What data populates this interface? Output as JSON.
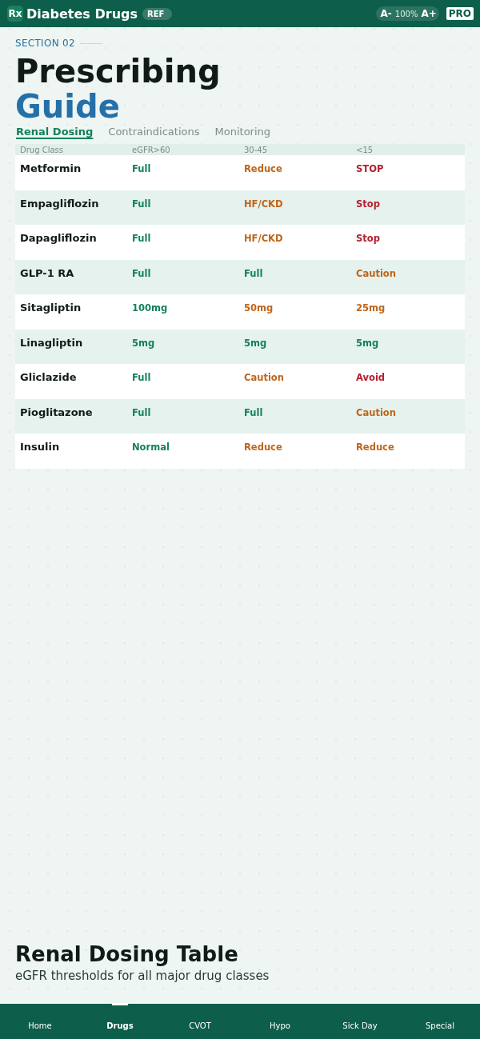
{
  "header": {
    "logo": "Rx",
    "title": "Diabetes Drugs",
    "badge": "REF",
    "font_controls": {
      "decrease": "A-",
      "zoom": "100%",
      "increase": "A+"
    },
    "plan_badge": "PRO"
  },
  "section": {
    "label": "SECTION 02",
    "title_line_1": "Prescribing",
    "title_line_2": "Guide"
  },
  "tabs": [
    {
      "label": "Renal Dosing",
      "selected": true
    },
    {
      "label": "Contraindications",
      "selected": false
    },
    {
      "label": "Monitoring",
      "selected": false
    }
  ],
  "table": {
    "columns": [
      "Drug Class",
      "eGFR>60",
      "30-45",
      "<15"
    ],
    "rows": [
      {
        "cells": [
          {
            "text": "Metformin"
          },
          {
            "text": "Full",
            "color": "#13805f"
          },
          {
            "text": "Reduce",
            "color": "#c0651a"
          },
          {
            "text": "STOP",
            "color": "#b3202e"
          }
        ]
      },
      {
        "cells": [
          {
            "text": "Empagliflozin"
          },
          {
            "text": "Full",
            "color": "#13805f"
          },
          {
            "text": "HF/CKD",
            "color": "#c0651a"
          },
          {
            "text": "Stop",
            "color": "#b3202e"
          }
        ]
      },
      {
        "cells": [
          {
            "text": "Dapagliflozin"
          },
          {
            "text": "Full",
            "color": "#13805f"
          },
          {
            "text": "HF/CKD",
            "color": "#c0651a"
          },
          {
            "text": "Stop",
            "color": "#b3202e"
          }
        ]
      },
      {
        "cells": [
          {
            "text": "GLP-1 RA"
          },
          {
            "text": "Full",
            "color": "#13805f"
          },
          {
            "text": "Full",
            "color": "#13805f"
          },
          {
            "text": "Caution",
            "color": "#c0651a"
          }
        ]
      },
      {
        "cells": [
          {
            "text": "Sitagliptin"
          },
          {
            "text": "100mg",
            "color": "#13805f"
          },
          {
            "text": "50mg",
            "color": "#c0651a"
          },
          {
            "text": "25mg",
            "color": "#c0651a"
          }
        ]
      },
      {
        "cells": [
          {
            "text": "Linagliptin"
          },
          {
            "text": "5mg",
            "color": "#13805f"
          },
          {
            "text": "5mg",
            "color": "#13805f"
          },
          {
            "text": "5mg",
            "color": "#13805f"
          }
        ]
      },
      {
        "cells": [
          {
            "text": "Gliclazide"
          },
          {
            "text": "Full",
            "color": "#13805f"
          },
          {
            "text": "Caution",
            "color": "#c0651a"
          },
          {
            "text": "Avoid",
            "color": "#b3202e"
          }
        ]
      },
      {
        "cells": [
          {
            "text": "Pioglitazone"
          },
          {
            "text": "Full",
            "color": "#13805f"
          },
          {
            "text": "Full",
            "color": "#13805f"
          },
          {
            "text": "Caution",
            "color": "#c0651a"
          }
        ]
      },
      {
        "cells": [
          {
            "text": "Insulin"
          },
          {
            "text": "Normal",
            "color": "#13805f"
          },
          {
            "text": "Reduce",
            "color": "#c0651a"
          },
          {
            "text": "Reduce",
            "color": "#c0651a"
          }
        ]
      }
    ]
  },
  "caption": {
    "title": "Renal Dosing Table",
    "subtitle": "eGFR thresholds for all major drug classes"
  },
  "bottom_nav": [
    {
      "label": "Home",
      "selected": false
    },
    {
      "label": "Drugs",
      "selected": true
    },
    {
      "label": "CVOT",
      "selected": false
    },
    {
      "label": "Hypo",
      "selected": false
    },
    {
      "label": "Sick Day",
      "selected": false
    },
    {
      "label": "Special",
      "selected": false
    }
  ]
}
